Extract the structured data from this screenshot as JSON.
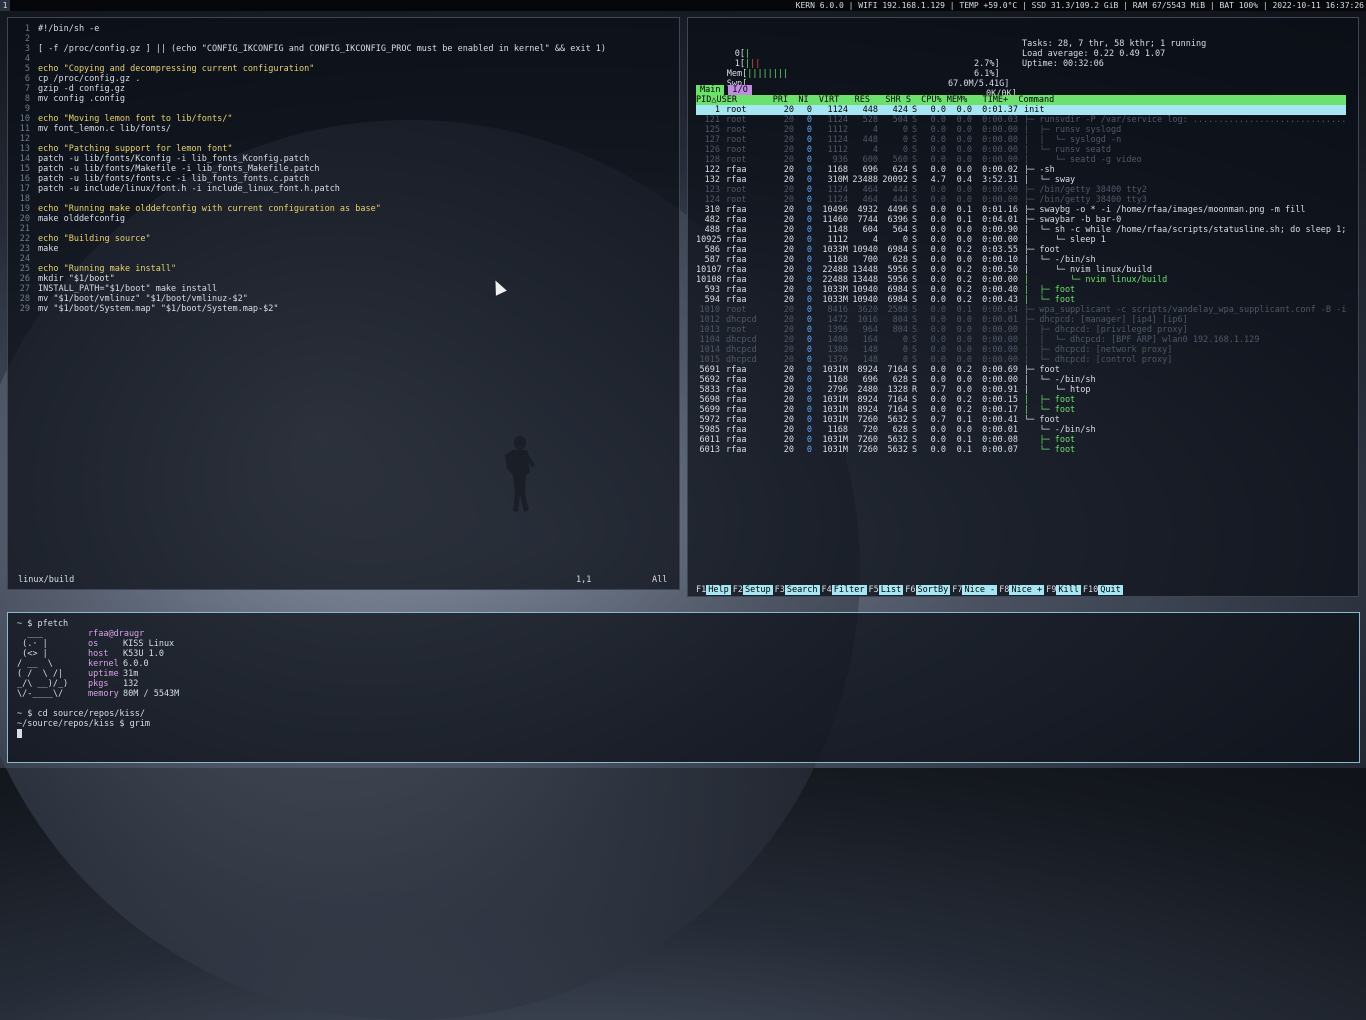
{
  "bar": {
    "workspace": "1",
    "status": "KERN 6.0.0 | WIFI 192.168.1.129 | TEMP +59.0°C | SSD 31.3/109.2 GiB | RAM 67/5543 MiB | BAT 100% | 2022-10-11 16:37:26"
  },
  "vim": {
    "lines": [
      {
        "n": "1",
        "t": "#!/bin/sh -e"
      },
      {
        "n": "2",
        "t": ""
      },
      {
        "n": "3",
        "t": "[ -f /proc/config.gz ] || (echo \"CONFIG_IKCONFIG and CONFIG_IKCONFIG_PROC must be enabled in kernel\" && exit 1)"
      },
      {
        "n": "4",
        "t": ""
      },
      {
        "n": "5",
        "t": "echo \"Copying and decompressing current configuration\""
      },
      {
        "n": "6",
        "t": "cp /proc/config.gz ."
      },
      {
        "n": "7",
        "t": "gzip -d config.gz"
      },
      {
        "n": "8",
        "t": "mv config .config"
      },
      {
        "n": "9",
        "t": ""
      },
      {
        "n": "10",
        "t": "echo \"Moving lemon font to lib/fonts/\""
      },
      {
        "n": "11",
        "t": "mv font_lemon.c lib/fonts/"
      },
      {
        "n": "12",
        "t": ""
      },
      {
        "n": "13",
        "t": "echo \"Patching support for lemon font\""
      },
      {
        "n": "14",
        "t": "patch -u lib/fonts/Kconfig -i lib_fonts_Kconfig.patch"
      },
      {
        "n": "15",
        "t": "patch -u lib/fonts/Makefile -i lib_fonts_Makefile.patch"
      },
      {
        "n": "16",
        "t": "patch -u lib/fonts/fonts.c -i lib_fonts_fonts.c.patch"
      },
      {
        "n": "17",
        "t": "patch -u include/linux/font.h -i include_linux_font.h.patch"
      },
      {
        "n": "18",
        "t": ""
      },
      {
        "n": "19",
        "t": "echo \"Running make olddefconfig with current configuration as base\""
      },
      {
        "n": "20",
        "t": "make olddefconfig"
      },
      {
        "n": "21",
        "t": ""
      },
      {
        "n": "22",
        "t": "echo \"Building source\""
      },
      {
        "n": "23",
        "t": "make"
      },
      {
        "n": "24",
        "t": ""
      },
      {
        "n": "25",
        "t": "echo \"Running make install\""
      },
      {
        "n": "26",
        "t": "mkdir \"$1/boot\""
      },
      {
        "n": "27",
        "t": "INSTALL_PATH=\"$1/boot\" make install"
      },
      {
        "n": "28",
        "t": "mv \"$1/boot/vmlinuz\" \"$1/boot/vmlinuz-$2\""
      },
      {
        "n": "29",
        "t": "mv \"$1/boot/System.map\" \"$1/boot/System.map-$2\""
      }
    ],
    "status_file": "linux/build",
    "status_pos": "1,1",
    "status_all": "All"
  },
  "htop": {
    "cpu0_label": "0[",
    "cpu0_value": "2.7%]",
    "cpu1_label": "1[",
    "cpu1_value": "6.1%]",
    "mem_label": "Mem[",
    "mem_value": "67.0M/5.41G]",
    "swp_label": "Swp[",
    "swp_value": "0K/0K]",
    "tasks": "Tasks: 28, 7 thr, 58 kthr; 1 running",
    "load": "Load average: 0.22 0.49 1.07",
    "uptime": "Uptime: 00:32:06",
    "tab_main": "Main",
    "tab_io": "I/O",
    "header": "PID△USER       PRI  NI  VIRT   RES   SHR S  CPU% MEM%   TIME+  Command",
    "processes": [
      {
        "pid": "1",
        "user": "root",
        "pri": "20",
        "ni": "0",
        "virt": "1124",
        "res": "448",
        "shr": "424",
        "s": "S",
        "cpu": "0.0",
        "mem": "0.0",
        "time": "0:01.37",
        "cmd": "init",
        "style": "sel"
      },
      {
        "pid": "121",
        "user": "root",
        "pri": "20",
        "ni": "0",
        "virt": "1124",
        "res": "528",
        "shr": "504",
        "s": "S",
        "cpu": "0.0",
        "mem": "0.0",
        "time": "0:00.03",
        "cmd": "├─ runsvdir -P /var/service log: ...............................",
        "style": "dim"
      },
      {
        "pid": "125",
        "user": "root",
        "pri": "20",
        "ni": "0",
        "virt": "1112",
        "res": "4",
        "shr": "0",
        "s": "S",
        "cpu": "0.0",
        "mem": "0.0",
        "time": "0:00.00",
        "cmd": "│  ├─ runsv syslogd",
        "style": "dim"
      },
      {
        "pid": "127",
        "user": "root",
        "pri": "20",
        "ni": "0",
        "virt": "1124",
        "res": "448",
        "shr": "0",
        "s": "S",
        "cpu": "0.0",
        "mem": "0.0",
        "time": "0:00.00",
        "cmd": "│  │  └─ syslogd -n",
        "style": "dim"
      },
      {
        "pid": "126",
        "user": "root",
        "pri": "20",
        "ni": "0",
        "virt": "1112",
        "res": "4",
        "shr": "0",
        "s": "S",
        "cpu": "0.0",
        "mem": "0.0",
        "time": "0:00.00",
        "cmd": "│  └─ runsv seatd",
        "style": "dim"
      },
      {
        "pid": "128",
        "user": "root",
        "pri": "20",
        "ni": "0",
        "virt": "936",
        "res": "600",
        "shr": "560",
        "s": "S",
        "cpu": "0.0",
        "mem": "0.0",
        "time": "0:00.00",
        "cmd": "│     └─ seatd -g video",
        "style": "dim"
      },
      {
        "pid": "122",
        "user": "rfaa",
        "pri": "20",
        "ni": "0",
        "virt": "1168",
        "res": "696",
        "shr": "624",
        "s": "S",
        "cpu": "0.0",
        "mem": "0.0",
        "time": "0:00.02",
        "cmd": "├─ -sh",
        "style": ""
      },
      {
        "pid": "132",
        "user": "rfaa",
        "pri": "20",
        "ni": "0",
        "virt": "310M",
        "res": "23488",
        "shr": "20092",
        "s": "S",
        "cpu": "4.7",
        "mem": "0.4",
        "time": "3:52.31",
        "cmd": "│  └─ sway",
        "style": ""
      },
      {
        "pid": "123",
        "user": "root",
        "pri": "20",
        "ni": "0",
        "virt": "1124",
        "res": "464",
        "shr": "444",
        "s": "S",
        "cpu": "0.0",
        "mem": "0.0",
        "time": "0:00.00",
        "cmd": "├─ /bin/getty 38400 tty2",
        "style": "dim"
      },
      {
        "pid": "124",
        "user": "root",
        "pri": "20",
        "ni": "0",
        "virt": "1124",
        "res": "464",
        "shr": "444",
        "s": "S",
        "cpu": "0.0",
        "mem": "0.0",
        "time": "0:00.00",
        "cmd": "├─ /bin/getty 38400 tty3",
        "style": "dim"
      },
      {
        "pid": "310",
        "user": "rfaa",
        "pri": "20",
        "ni": "0",
        "virt": "10496",
        "res": "4932",
        "shr": "4496",
        "s": "S",
        "cpu": "0.0",
        "mem": "0.1",
        "time": "0:01.16",
        "cmd": "├─ swaybg -o * -i /home/rfaa/images/moonman.png -m fill",
        "style": ""
      },
      {
        "pid": "482",
        "user": "rfaa",
        "pri": "20",
        "ni": "0",
        "virt": "11460",
        "res": "7744",
        "shr": "6396",
        "s": "S",
        "cpu": "0.0",
        "mem": "0.1",
        "time": "0:04.01",
        "cmd": "├─ swaybar -b bar-0",
        "style": ""
      },
      {
        "pid": "488",
        "user": "rfaa",
        "pri": "20",
        "ni": "0",
        "virt": "1148",
        "res": "604",
        "shr": "564",
        "s": "S",
        "cpu": "0.0",
        "mem": "0.0",
        "time": "0:00.90",
        "cmd": "│  └─ sh -c while /home/rfaa/scripts/statusline.sh; do sleep 1; d",
        "style": ""
      },
      {
        "pid": "10925",
        "user": "rfaa",
        "pri": "20",
        "ni": "0",
        "virt": "1112",
        "res": "4",
        "shr": "0",
        "s": "S",
        "cpu": "0.0",
        "mem": "0.0",
        "time": "0:00.00",
        "cmd": "│     └─ sleep 1",
        "style": ""
      },
      {
        "pid": "586",
        "user": "rfaa",
        "pri": "20",
        "ni": "0",
        "virt": "1033M",
        "res": "10940",
        "shr": "6984",
        "s": "S",
        "cpu": "0.0",
        "mem": "0.2",
        "time": "0:03.55",
        "cmd": "├─ foot",
        "style": ""
      },
      {
        "pid": "587",
        "user": "rfaa",
        "pri": "20",
        "ni": "0",
        "virt": "1168",
        "res": "700",
        "shr": "628",
        "s": "S",
        "cpu": "0.0",
        "mem": "0.0",
        "time": "0:00.10",
        "cmd": "│  └─ -/bin/sh",
        "style": ""
      },
      {
        "pid": "10107",
        "user": "rfaa",
        "pri": "20",
        "ni": "0",
        "virt": "22488",
        "res": "13448",
        "shr": "5956",
        "s": "S",
        "cpu": "0.0",
        "mem": "0.2",
        "time": "0:00.50",
        "cmd": "│     └─ nvim linux/build",
        "style": ""
      },
      {
        "pid": "10108",
        "user": "rfaa",
        "pri": "20",
        "ni": "0",
        "virt": "22488",
        "res": "13448",
        "shr": "5956",
        "s": "S",
        "cpu": "0.0",
        "mem": "0.2",
        "time": "0:00.00",
        "cmd": "│        └─ nvim linux/build",
        "style": "green"
      },
      {
        "pid": "593",
        "user": "rfaa",
        "pri": "20",
        "ni": "0",
        "virt": "1033M",
        "res": "10940",
        "shr": "6984",
        "s": "S",
        "cpu": "0.0",
        "mem": "0.2",
        "time": "0:00.40",
        "cmd": "│  ├─ foot",
        "style": "green"
      },
      {
        "pid": "594",
        "user": "rfaa",
        "pri": "20",
        "ni": "0",
        "virt": "1033M",
        "res": "10940",
        "shr": "6984",
        "s": "S",
        "cpu": "0.0",
        "mem": "0.2",
        "time": "0:00.43",
        "cmd": "│  └─ foot",
        "style": "green"
      },
      {
        "pid": "1010",
        "user": "root",
        "pri": "20",
        "ni": "0",
        "virt": "8416",
        "res": "3620",
        "shr": "2588",
        "s": "S",
        "cpu": "0.0",
        "mem": "0.1",
        "time": "0:00.04",
        "cmd": "├─ wpa_supplicant -c scripts/vandelay_wpa_supplicant.conf -B -i w",
        "style": "dim"
      },
      {
        "pid": "1012",
        "user": "dhcpcd",
        "pri": "20",
        "ni": "0",
        "virt": "1472",
        "res": "1016",
        "shr": "804",
        "s": "S",
        "cpu": "0.0",
        "mem": "0.0",
        "time": "0:00.01",
        "cmd": "├─ dhcpcd: [manager] [ip4] [ip6]",
        "style": "dim"
      },
      {
        "pid": "1013",
        "user": "root",
        "pri": "20",
        "ni": "0",
        "virt": "1396",
        "res": "964",
        "shr": "804",
        "s": "S",
        "cpu": "0.0",
        "mem": "0.0",
        "time": "0:00.00",
        "cmd": "│  ├─ dhcpcd: [privileged proxy]",
        "style": "dim"
      },
      {
        "pid": "1104",
        "user": "dhcpcd",
        "pri": "20",
        "ni": "0",
        "virt": "1408",
        "res": "164",
        "shr": "0",
        "s": "S",
        "cpu": "0.0",
        "mem": "0.0",
        "time": "0:00.00",
        "cmd": "│  │  └─ dhcpcd: [BPF ARP] wlan0 192.168.1.129",
        "style": "dim"
      },
      {
        "pid": "1014",
        "user": "dhcpcd",
        "pri": "20",
        "ni": "0",
        "virt": "1380",
        "res": "148",
        "shr": "0",
        "s": "S",
        "cpu": "0.0",
        "mem": "0.0",
        "time": "0:00.00",
        "cmd": "│  ├─ dhcpcd: [network proxy]",
        "style": "dim"
      },
      {
        "pid": "1015",
        "user": "dhcpcd",
        "pri": "20",
        "ni": "0",
        "virt": "1376",
        "res": "148",
        "shr": "0",
        "s": "S",
        "cpu": "0.0",
        "mem": "0.0",
        "time": "0:00.00",
        "cmd": "│  └─ dhcpcd: [control proxy]",
        "style": "dim"
      },
      {
        "pid": "5691",
        "user": "rfaa",
        "pri": "20",
        "ni": "0",
        "virt": "1031M",
        "res": "8924",
        "shr": "7164",
        "s": "S",
        "cpu": "0.0",
        "mem": "0.2",
        "time": "0:00.69",
        "cmd": "├─ foot",
        "style": ""
      },
      {
        "pid": "5692",
        "user": "rfaa",
        "pri": "20",
        "ni": "0",
        "virt": "1168",
        "res": "696",
        "shr": "628",
        "s": "S",
        "cpu": "0.0",
        "mem": "0.0",
        "time": "0:00.00",
        "cmd": "│  └─ -/bin/sh",
        "style": ""
      },
      {
        "pid": "5833",
        "user": "rfaa",
        "pri": "20",
        "ni": "0",
        "virt": "2796",
        "res": "2480",
        "shr": "1328",
        "s": "R",
        "cpu": "0.7",
        "mem": "0.0",
        "time": "0:00.91",
        "cmd": "│     └─ htop",
        "style": ""
      },
      {
        "pid": "5698",
        "user": "rfaa",
        "pri": "20",
        "ni": "0",
        "virt": "1031M",
        "res": "8924",
        "shr": "7164",
        "s": "S",
        "cpu": "0.0",
        "mem": "0.2",
        "time": "0:00.15",
        "cmd": "│  ├─ foot",
        "style": "green"
      },
      {
        "pid": "5699",
        "user": "rfaa",
        "pri": "20",
        "ni": "0",
        "virt": "1031M",
        "res": "8924",
        "shr": "7164",
        "s": "S",
        "cpu": "0.0",
        "mem": "0.2",
        "time": "0:00.17",
        "cmd": "│  └─ foot",
        "style": "green"
      },
      {
        "pid": "5972",
        "user": "rfaa",
        "pri": "20",
        "ni": "0",
        "virt": "1031M",
        "res": "7260",
        "shr": "5632",
        "s": "S",
        "cpu": "0.7",
        "mem": "0.1",
        "time": "0:00.41",
        "cmd": "└─ foot",
        "style": ""
      },
      {
        "pid": "5985",
        "user": "rfaa",
        "pri": "20",
        "ni": "0",
        "virt": "1168",
        "res": "720",
        "shr": "628",
        "s": "S",
        "cpu": "0.0",
        "mem": "0.0",
        "time": "0:00.01",
        "cmd": "   └─ -/bin/sh",
        "style": ""
      },
      {
        "pid": "6011",
        "user": "rfaa",
        "pri": "20",
        "ni": "0",
        "virt": "1031M",
        "res": "7260",
        "shr": "5632",
        "s": "S",
        "cpu": "0.0",
        "mem": "0.1",
        "time": "0:00.08",
        "cmd": "   ├─ foot",
        "style": "green"
      },
      {
        "pid": "6013",
        "user": "rfaa",
        "pri": "20",
        "ni": "0",
        "virt": "1031M",
        "res": "7260",
        "shr": "5632",
        "s": "S",
        "cpu": "0.0",
        "mem": "0.1",
        "time": "0:00.07",
        "cmd": "   └─ foot",
        "style": "green"
      }
    ],
    "fkeys": [
      {
        "k": "F1",
        "l": "Help"
      },
      {
        "k": "F2",
        "l": "Setup"
      },
      {
        "k": "F3",
        "l": "Search"
      },
      {
        "k": "F4",
        "l": "Filter"
      },
      {
        "k": "F5",
        "l": "List"
      },
      {
        "k": "F6",
        "l": "SortBy"
      },
      {
        "k": "F7",
        "l": "Nice -"
      },
      {
        "k": "F8",
        "l": "Nice +"
      },
      {
        "k": "F9",
        "l": "Kill"
      },
      {
        "k": "F10",
        "l": "Quit"
      }
    ]
  },
  "term": {
    "cmd1": "~ $ pfetch",
    "userhost": "rfaa@draugr",
    "ascii": [
      "  ___",
      " (.· |",
      " (<> |",
      "/ __  \\",
      "( /  \\ /|",
      "_/\\ __)/_)",
      "\\/-____\\/"
    ],
    "keys": [
      "os",
      "host",
      "kernel",
      "uptime",
      "pkgs",
      "memory"
    ],
    "vals": [
      "KISS Linux",
      "K53U 1.0",
      "6.0.0",
      "31m",
      "132",
      "80M / 5543M"
    ],
    "cmd2": "~ $ cd source/repos/kiss/",
    "cmd3": "~/source/repos/kiss $ grim"
  }
}
